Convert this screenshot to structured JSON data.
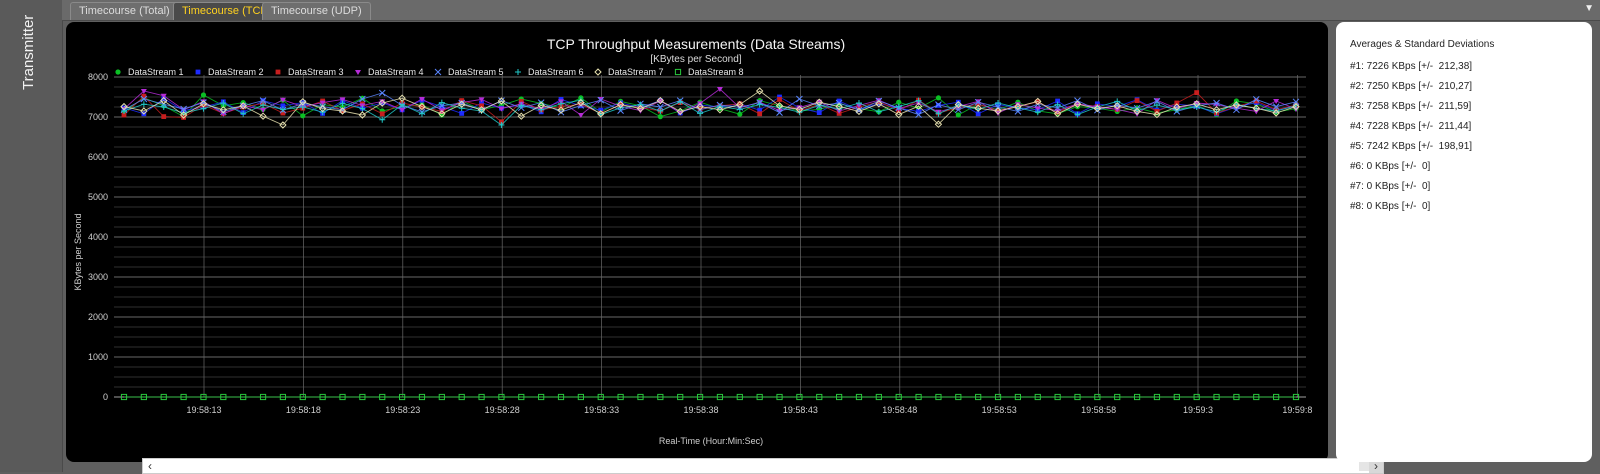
{
  "side": {
    "label": "Transmitter"
  },
  "tabs": [
    {
      "label": "Timecourse (Total)"
    },
    {
      "label": "Timecourse (TCP)"
    },
    {
      "label": "Timecourse (UDP)"
    }
  ],
  "chart_data": {
    "type": "scatter",
    "title": "TCP Throughput Measurements (Data Streams)",
    "subtitle": "[KBytes per Second]",
    "xlabel": "Real-Time (Hour:Min:Sec)",
    "ylabel": "KBytes per Second",
    "ylim": [
      0,
      8000
    ],
    "y_ticks": [
      0,
      1000,
      2000,
      3000,
      4000,
      5000,
      6000,
      7000,
      8000
    ],
    "x": [
      "19:58:13",
      "19:58:18",
      "19:58:23",
      "19:58:28",
      "19:58:33",
      "19:58:38",
      "19:58:43",
      "19:58:48",
      "19:58:53",
      "19:58:58",
      "19:59:3",
      "19:59:8"
    ],
    "grid": true,
    "legend": "top-left",
    "series": [
      {
        "name": "DataStream 1",
        "color": "#0bbf24",
        "marker": "circle",
        "values": [
          7130,
          7480,
          7280,
          7010,
          7550,
          7280,
          7360,
          7190,
          7420,
          7030,
          7310,
          7250,
          7470,
          7150,
          7260,
          7310,
          7050,
          7400,
          7180,
          7290,
          7450,
          7340,
          7230,
          7480,
          7120,
          7390,
          7280,
          7010,
          7150,
          7370,
          7210,
          7070,
          7410,
          7280,
          7150,
          7190,
          7330,
          7210,
          7130,
          7370,
          7220,
          7480,
          7050,
          7320,
          7180,
          7370,
          7150,
          7080,
          7260,
          7220,
          7140,
          7230,
          7100,
          7180,
          7300,
          7060,
          7400,
          7330,
          7120,
          7210
        ]
      },
      {
        "name": "DataStream 2",
        "color": "#1d2bff",
        "marker": "square",
        "values": [
          7230,
          7080,
          7460,
          7160,
          7250,
          7380,
          7110,
          7410,
          7280,
          7360,
          7090,
          7410,
          7220,
          7350,
          7180,
          7420,
          7260,
          7090,
          7350,
          7220,
          7310,
          7130,
          7440,
          7280,
          7170,
          7350,
          7240,
          7410,
          7100,
          7300,
          7250,
          7330,
          7170,
          7500,
          7230,
          7110,
          7400,
          7180,
          7340,
          7220,
          7140,
          7290,
          7370,
          7080,
          7310,
          7230,
          7180,
          7400,
          7080,
          7330,
          7260,
          7430,
          7170,
          7320,
          7270,
          7080,
          7250,
          7360,
          7160,
          7290
        ]
      },
      {
        "name": "DataStream 3",
        "color": "#c81e1e",
        "marker": "square",
        "values": [
          7050,
          7520,
          7010,
          6990,
          7300,
          7090,
          7250,
          7340,
          7100,
          7220,
          7400,
          7160,
          7330,
          7080,
          7350,
          7250,
          7140,
          7410,
          7280,
          6880,
          7390,
          7180,
          7260,
          7320,
          7090,
          7300,
          7240,
          7150,
          7360,
          7210,
          7280,
          7330,
          7080,
          7440,
          7150,
          7320,
          7090,
          7250,
          7380,
          7160,
          7420,
          7100,
          7230,
          7320,
          7160,
          7260,
          7380,
          7120,
          7330,
          7260,
          7190,
          7410,
          7140,
          7350,
          7610,
          7100,
          7260,
          7400,
          7180,
          7300
        ]
      },
      {
        "name": "DataStream 4",
        "color": "#b52bd6",
        "marker": "triangle",
        "values": [
          7200,
          7650,
          7530,
          7180,
          7390,
          7080,
          7290,
          7180,
          7430,
          7260,
          7360,
          7440,
          7290,
          7390,
          7180,
          7450,
          7170,
          7360,
          7440,
          7210,
          7330,
          7200,
          7390,
          7050,
          7450,
          7270,
          7160,
          7400,
          7110,
          7340,
          7700,
          7230,
          7370,
          7160,
          7240,
          7380,
          7150,
          7290,
          7420,
          7210,
          7350,
          7130,
          7260,
          7390,
          7100,
          7320,
          7220,
          7160,
          7330,
          7250,
          7190,
          7080,
          7420,
          7210,
          7350,
          7310,
          7220,
          7140,
          7400,
          7200
        ]
      },
      {
        "name": "DataStream 5",
        "color": "#5a86ff",
        "marker": "x",
        "values": [
          7180,
          7450,
          7320,
          7200,
          7360,
          7130,
          7280,
          7410,
          7170,
          7340,
          7260,
          7180,
          7450,
          7600,
          7290,
          7130,
          7280,
          7350,
          7170,
          7410,
          7230,
          7360,
          7120,
          7290,
          7420,
          7160,
          7330,
          7250,
          7410,
          7180,
          7300,
          7240,
          7360,
          7110,
          7450,
          7280,
          7350,
          7170,
          7400,
          7230,
          7060,
          7310,
          7180,
          7370,
          7250,
          7140,
          7320,
          7230,
          7410,
          7170,
          7300,
          7220,
          7390,
          7140,
          7280,
          7350,
          7180,
          7440,
          7260,
          7380
        ]
      },
      {
        "name": "DataStream 6",
        "color": "#20c8c8",
        "marker": "plus",
        "values": [
          7150,
          7320,
          7250,
          7100,
          7210,
          7350,
          7080,
          7300,
          7190,
          7250,
          7120,
          7340,
          7210,
          6930,
          7310,
          7080,
          7360,
          7220,
          7150,
          6800,
          7290,
          7180,
          7330,
          7420,
          7060,
          7230,
          7310,
          7150,
          7380,
          7090,
          7260,
          7190,
          7310,
          7240,
          7120,
          7290,
          7200,
          7350,
          7130,
          7260,
          7410,
          7080,
          7300,
          7190,
          7350,
          7230,
          7120,
          7310,
          7060,
          7250,
          7390,
          7160,
          7300,
          7180,
          7250,
          7130,
          7320,
          7210,
          7150,
          7280
        ]
      },
      {
        "name": "DataStream 7",
        "color": "#e8e2b0",
        "marker": "diamond",
        "values": [
          7260,
          7150,
          7410,
          7050,
          7330,
          7180,
          7280,
          7020,
          6800,
          7380,
          7210,
          7150,
          7050,
          7350,
          7470,
          7260,
          7080,
          7320,
          7180,
          7400,
          7020,
          7290,
          7170,
          7360,
          7080,
          7310,
          7210,
          7410,
          7140,
          7260,
          7180,
          7310,
          7650,
          7280,
          7190,
          7370,
          7260,
          7140,
          7330,
          7060,
          7270,
          6820,
          7310,
          7220,
          7150,
          7260,
          7390,
          7080,
          7320,
          7210,
          7280,
          7140,
          7060,
          7250,
          7330,
          7180,
          7300,
          7220,
          7100,
          7260
        ]
      },
      {
        "name": "DataStream 8",
        "color": "#28c83c",
        "marker": "hollow-square",
        "values": [
          0,
          0,
          0,
          0,
          0,
          0,
          0,
          0,
          0,
          0,
          0,
          0,
          0,
          0,
          0,
          0,
          0,
          0,
          0,
          0,
          0,
          0,
          0,
          0,
          0,
          0,
          0,
          0,
          0,
          0,
          0,
          0,
          0,
          0,
          0,
          0,
          0,
          0,
          0,
          0,
          0,
          0,
          0,
          0,
          0,
          0,
          0,
          0,
          0,
          0,
          0,
          0,
          0,
          0,
          0,
          0,
          0,
          0,
          0,
          0
        ]
      }
    ]
  },
  "stats": {
    "title": "Averages & Standard Deviations",
    "lines": [
      "#1: 7226 KBps [+/-  212,38]",
      "#2: 7250 KBps [+/-  210,27]",
      "#3: 7258 KBps [+/-  211,59]",
      "#4: 7228 KBps [+/-  211,44]",
      "#5: 7242 KBps [+/-  198,91]",
      "#6: 0 KBps [+/-  0]",
      "#7: 0 KBps [+/-  0]",
      "#8: 0 KBps [+/-  0]"
    ]
  }
}
